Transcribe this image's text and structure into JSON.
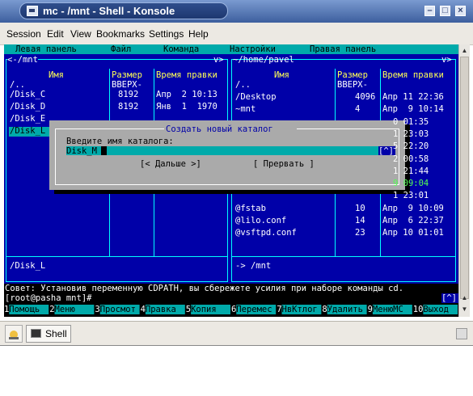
{
  "window": {
    "title": "mc - /mnt - Shell - Konsole"
  },
  "menubar": {
    "items": [
      "Session",
      "Edit",
      "View",
      "Bookmarks",
      "Settings",
      "Help"
    ]
  },
  "mc_menu": {
    "items": [
      "Левая панель",
      "Файл",
      "Команда",
      "Настройки",
      "Правая панель"
    ]
  },
  "left_panel": {
    "path": "/mnt",
    "header": {
      "name": "Имя",
      "size": "Размер",
      "time": "Время правки"
    },
    "updir": "/..",
    "updir_size": "ВВЕРХ-",
    "rows": [
      {
        "name": "/Disk_C",
        "size": "8192",
        "date": "Апр  2 10:13"
      },
      {
        "name": "/Disk_D",
        "size": "8192",
        "date": "Янв  1  1970"
      },
      {
        "name": "/Disk_E",
        "size": "",
        "date": ""
      },
      {
        "name": "/Disk_L",
        "size": "",
        "date": ""
      }
    ],
    "status": "/Disk_L"
  },
  "right_panel": {
    "path": "~/home/pavel",
    "header": {
      "name": "Имя",
      "size": "Размер",
      "time": "Время правки"
    },
    "updir": "/..",
    "updir_size": "ВВЕРХ-",
    "rows": [
      {
        "name": "/Desktop",
        "size": "4096",
        "date": "Апр 11 22:36"
      },
      {
        "name": "~mnt",
        "size": "4",
        "date": "Апр  9 10:14"
      },
      {
        "name": "",
        "size": "",
        "date": "0 01:35"
      },
      {
        "name": "",
        "size": "",
        "date": "1 23:03"
      },
      {
        "name": "",
        "size": "",
        "date": "5 22:20"
      },
      {
        "name": "",
        "size": "",
        "date": "2 00:58"
      },
      {
        "name": "",
        "size": "",
        "date": "1 21:44"
      },
      {
        "name": "",
        "size": "",
        "date": "9 09:04"
      },
      {
        "name": "",
        "size": "",
        "date": "1 23:01"
      },
      {
        "name": "@fstab",
        "size": "10",
        "date": "Апр  9 10:09"
      },
      {
        "name": "@lilo.conf",
        "size": "14",
        "date": "Апр  6 22:37"
      },
      {
        "name": "@vsftpd.conf",
        "size": "23",
        "date": "Апр 10 01:01"
      }
    ],
    "status": "-> /mnt"
  },
  "dialog": {
    "title": "Создать новый каталог",
    "prompt": "Введите имя каталога:",
    "value": "Disk_M",
    "history": "[^]",
    "ok": "[< Дальше >]",
    "cancel": "[ Прервать ]"
  },
  "hint": "Совет: Установив переменную CDPATH, вы сбережете усилия при наборе команды cd.",
  "prompt": "[root@pasha mnt]#",
  "prompt_history": "[^]",
  "fkeys": [
    {
      "num": "1",
      "label": "Помощь"
    },
    {
      "num": "2",
      "label": "Меню"
    },
    {
      "num": "3",
      "label": "Просмот"
    },
    {
      "num": "4",
      "label": "Правка"
    },
    {
      "num": "5",
      "label": "Копия"
    },
    {
      "num": "6",
      "label": "Перемес"
    },
    {
      "num": "7",
      "label": "НвКтлог"
    },
    {
      "num": "8",
      "label": "Удалить"
    },
    {
      "num": "9",
      "label": "МенюМС"
    },
    {
      "num": "10",
      "label": "Выход"
    }
  ],
  "taskbar": {
    "task": "Shell"
  },
  "colors": {
    "term_bg": "#0000a8",
    "cyan": "#00aaaa",
    "text": "#ffffff",
    "yellow": "#ffff55",
    "dialog_bg": "#aaaaaa",
    "black": "#000000"
  },
  "icons": [
    "konsole-icon",
    "minimize-icon",
    "maximize-icon",
    "close-icon",
    "kmenu-icon",
    "terminal-icon"
  ]
}
